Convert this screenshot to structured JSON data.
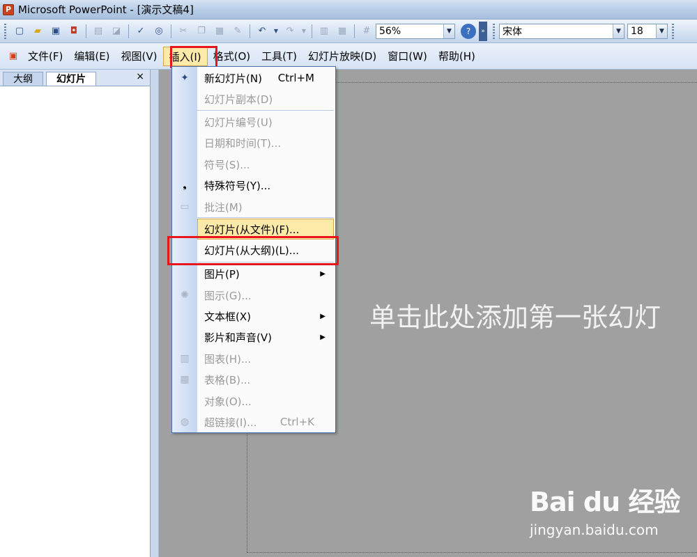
{
  "window": {
    "title": "Microsoft PowerPoint - [演示文稿4]"
  },
  "toolbar": {
    "zoom": "56%",
    "font": "宋体",
    "font_size": "18"
  },
  "menubar": {
    "items": [
      "文件(F)",
      "编辑(E)",
      "视图(V)",
      "插入(I)",
      "格式(O)",
      "工具(T)",
      "幻灯片放映(D)",
      "窗口(W)",
      "帮助(H)"
    ]
  },
  "leftpane": {
    "tabs": [
      "大纲",
      "幻灯片"
    ],
    "close": "×"
  },
  "slide": {
    "placeholder": "单击此处添加第一张幻灯"
  },
  "insert_menu": {
    "items": [
      {
        "label": "新幻灯片(N)",
        "shortcut": "Ctrl+M"
      },
      {
        "label": "幻灯片副本(D)"
      },
      {
        "label": "幻灯片编号(U)"
      },
      {
        "label": "日期和时间(T)..."
      },
      {
        "label": "符号(S)..."
      },
      {
        "label": "特殊符号(Y)..."
      },
      {
        "label": "批注(M)"
      },
      {
        "label": "幻灯片(从文件)(F)..."
      },
      {
        "label": "幻灯片(从大纲)(L)..."
      },
      {
        "label": "图片(P)"
      },
      {
        "label": "图示(G)..."
      },
      {
        "label": "文本框(X)"
      },
      {
        "label": "影片和声音(V)"
      },
      {
        "label": "图表(H)..."
      },
      {
        "label": "表格(B)..."
      },
      {
        "label": "对象(O)..."
      },
      {
        "label": "超链接(I)...",
        "shortcut": "Ctrl+K"
      }
    ]
  },
  "watermark": {
    "logo": "Bai du 经验",
    "url": "jingyan.baidu.com"
  }
}
